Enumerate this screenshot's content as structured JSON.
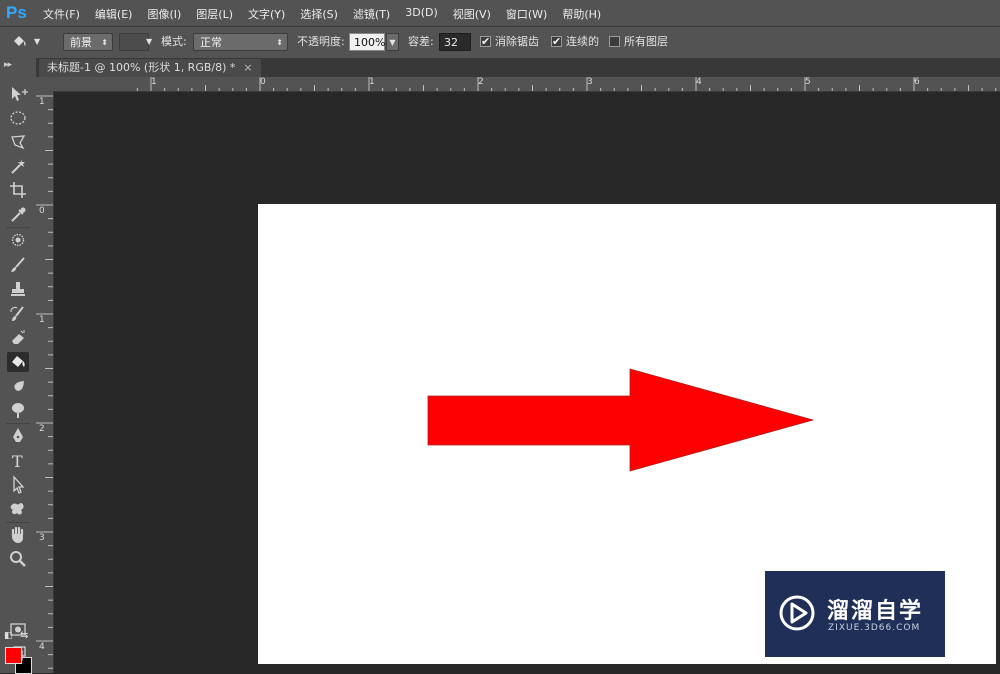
{
  "app": {
    "logo": "Ps"
  },
  "menu": [
    "文件(F)",
    "编辑(E)",
    "图像(I)",
    "图层(L)",
    "文字(Y)",
    "选择(S)",
    "滤镜(T)",
    "3D(D)",
    "视图(V)",
    "窗口(W)",
    "帮助(H)"
  ],
  "options": {
    "fill_source": "前景",
    "mode_label": "模式:",
    "mode_value": "正常",
    "opacity_label": "不透明度:",
    "opacity_value": "100%",
    "tolerance_label": "容差:",
    "tolerance_value": "32",
    "antialias_label": "消除锯齿",
    "antialias_checked": true,
    "contiguous_label": "连续的",
    "contiguous_checked": true,
    "all_layers_label": "所有图层",
    "all_layers_checked": false
  },
  "document_tab": {
    "title": "未标题-1 @ 100% (形状 1, RGB/8) *",
    "close": "×"
  },
  "ruler_top": [
    "1",
    "0",
    "1",
    "2",
    "3",
    "4",
    "5",
    "6"
  ],
  "ruler_left": [
    "1",
    "0",
    "1",
    "2",
    "3",
    "4"
  ],
  "colors": {
    "foreground": "#ff0000",
    "background": "#000000",
    "shape_fill": "#ff0000",
    "canvas": "#ffffff"
  },
  "tools": [
    "move-icon",
    "elliptical-marquee-icon",
    "lasso-icon",
    "magic-wand-icon",
    "crop-icon",
    "eyedropper-icon",
    "healing-brush-icon",
    "brush-icon",
    "clone-stamp-icon",
    "history-brush-icon",
    "eraser-icon",
    "paint-bucket-icon",
    "blur-icon",
    "dodge-icon",
    "pen-icon",
    "type-icon",
    "path-selection-icon",
    "custom-shape-icon",
    "hand-icon",
    "zoom-icon"
  ],
  "active_tool": "paint-bucket-icon",
  "watermark": {
    "title": "溜溜自学",
    "url": "ZIXUE.3D66.COM"
  }
}
